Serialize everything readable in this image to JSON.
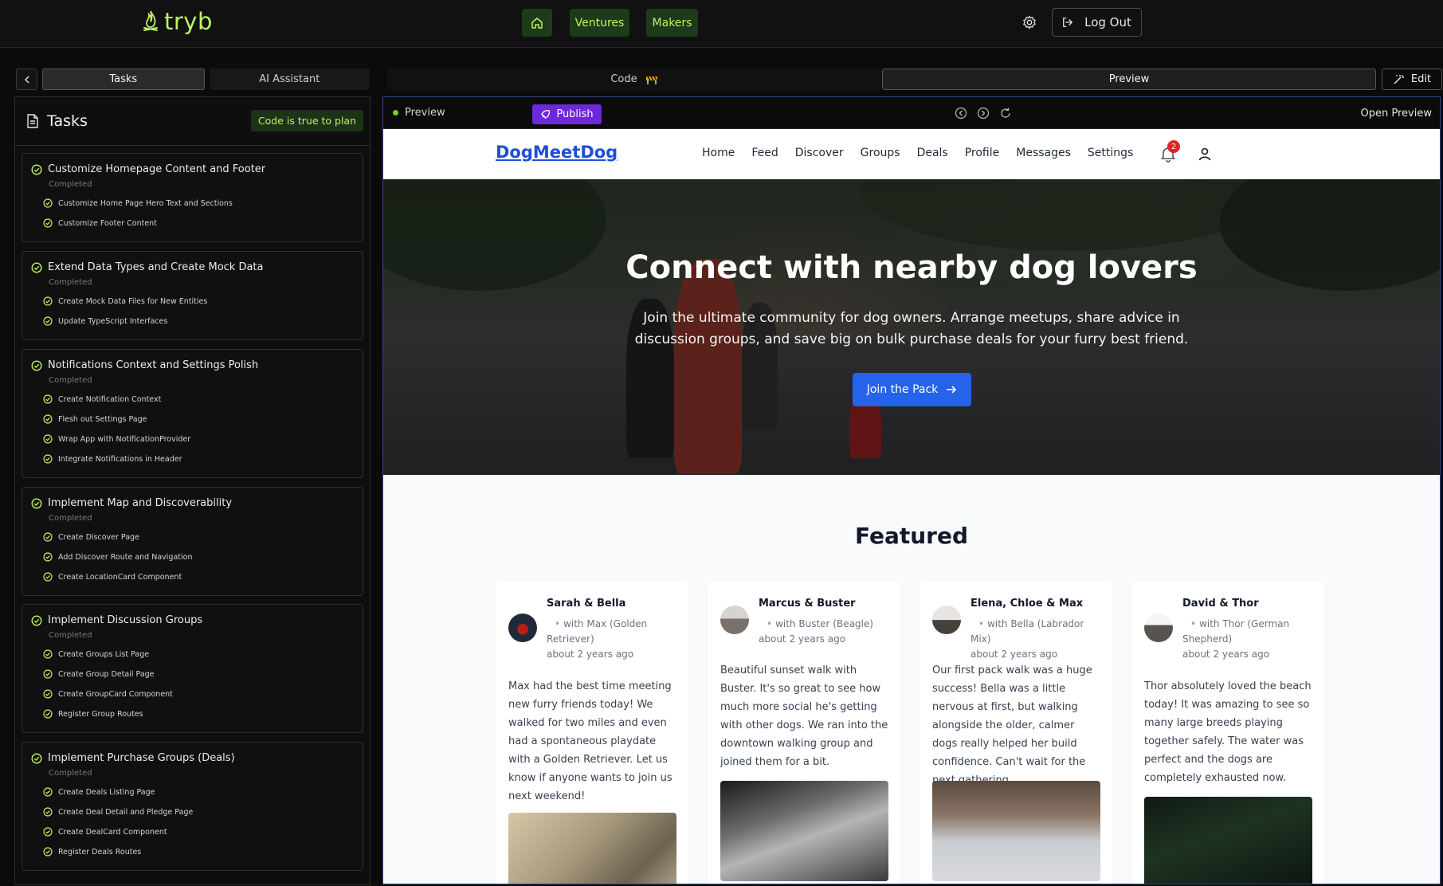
{
  "app": {
    "logo_text": "tryb",
    "nav": {
      "ventures": "Ventures",
      "makers": "Makers"
    },
    "logout_label": "Log Out"
  },
  "left": {
    "tabs": {
      "tasks": "Tasks",
      "assistant": "AI Assistant"
    },
    "title": "Tasks",
    "plan_badge": "Code is true to plan",
    "groups": [
      {
        "title": "Customize Homepage Content and Footer",
        "status": "Completed",
        "items": [
          "Customize Home Page Hero Text and Sections",
          "Customize Footer Content"
        ]
      },
      {
        "title": "Extend Data Types and Create Mock Data",
        "status": "Completed",
        "items": [
          "Create Mock Data Files for New Entities",
          "Update TypeScript Interfaces"
        ]
      },
      {
        "title": "Notifications Context and Settings Polish",
        "status": "Completed",
        "items": [
          "Create Notification Context",
          "Flesh out Settings Page",
          "Wrap App with NotificationProvider",
          "Integrate Notifications in Header"
        ]
      },
      {
        "title": "Implement Map and Discoverability",
        "status": "Completed",
        "items": [
          "Create Discover Page",
          "Add Discover Route and Navigation",
          "Create LocationCard Component"
        ]
      },
      {
        "title": "Implement Discussion Groups",
        "status": "Completed",
        "items": [
          "Create Groups List Page",
          "Create Group Detail Page",
          "Create GroupCard Component",
          "Register Group Routes"
        ]
      },
      {
        "title": "Implement Purchase Groups (Deals)",
        "status": "Completed",
        "items": [
          "Create Deals Listing Page",
          "Create Deal Detail and Pledge Page",
          "Create DealCard Component",
          "Register Deals Routes"
        ]
      }
    ]
  },
  "right": {
    "tabs": {
      "code": "Code",
      "preview": "Preview",
      "edit": "Edit"
    },
    "toolbar": {
      "preview_label": "Preview",
      "publish": "Publish",
      "open_preview": "Open Preview"
    }
  },
  "site": {
    "logo": "DogMeetDog",
    "nav": [
      "Home",
      "Feed",
      "Discover",
      "Groups",
      "Deals",
      "Profile",
      "Messages",
      "Settings"
    ],
    "notification_count": "2",
    "hero": {
      "title": "Connect with nearby dog lovers",
      "subtitle": "Join the ultimate community for dog owners. Arrange meetups, share advice in discussion groups, and save big on bulk purchase deals for your furry best friend.",
      "cta": "Join the Pack"
    },
    "featured_title": "Featured",
    "posts": [
      {
        "author": "Sarah & Bella",
        "with": "with Max (Golden Retriever)",
        "time": "about 2 years ago",
        "body": "Max had the best time meeting new furry friends today! We walked for two miles and even had a spontaneous playdate with a Golden Retriever. Let us know if anyone wants to join us next weekend!"
      },
      {
        "author": "Marcus & Buster",
        "with": "with Buster (Beagle)",
        "time": "about 2 years ago",
        "body": "Beautiful sunset walk with Buster. It's so great to see how much more social he's getting with other dogs. We ran into the downtown walking group and joined them for a bit."
      },
      {
        "author": "Elena, Chloe & Max",
        "with": "with Bella (Labrador Mix)",
        "time": "about 2 years ago",
        "body": "Our first pack walk was a huge success! Bella was a little nervous at first, but walking alongside the older, calmer dogs really helped her build confidence. Can't wait for the next gathering."
      },
      {
        "author": "David & Thor",
        "with": "with Thor (German Shepherd)",
        "time": "about 2 years ago",
        "body": "Thor absolutely loved the beach today! It was amazing to see so many large breeds playing together safely. The water was perfect and the dogs are completely exhausted now."
      }
    ]
  },
  "colors": {
    "accent": "#bef264",
    "brand_blue": "#2563eb",
    "publish": "#6d28d9",
    "badge_red": "#dc2626"
  }
}
